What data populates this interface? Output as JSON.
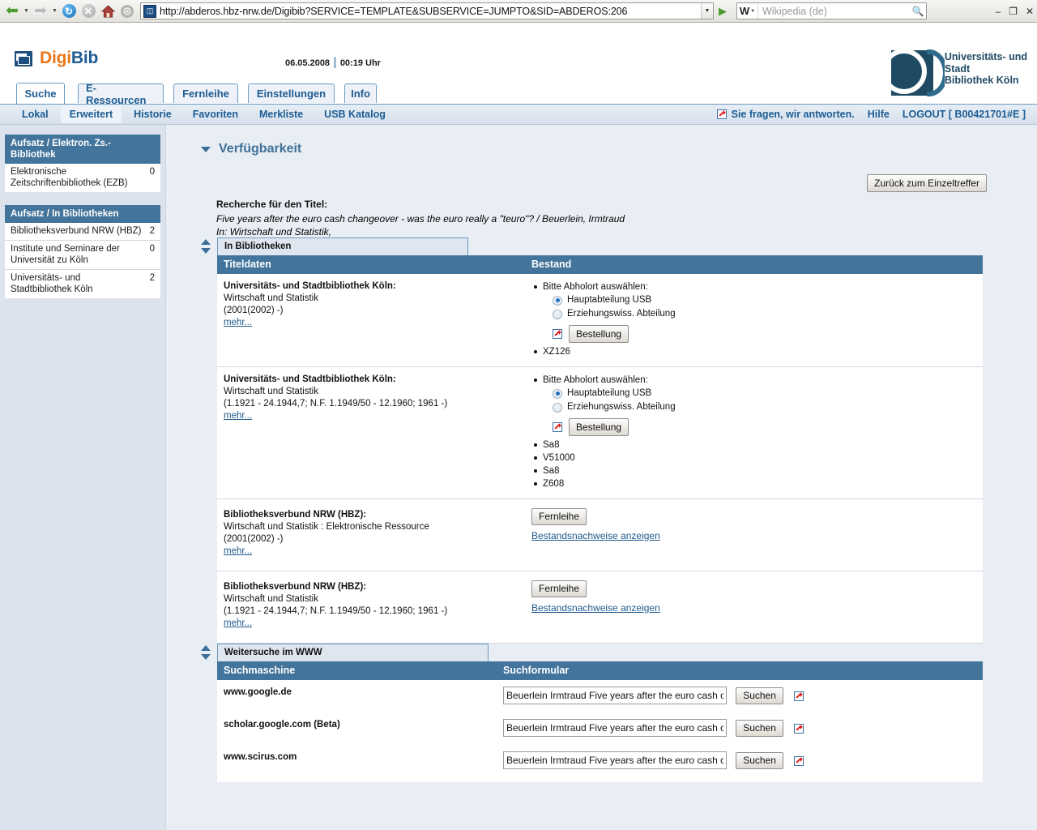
{
  "browser": {
    "back_icon": "back-arrow-icon",
    "forward_icon": "forward-arrow-icon",
    "reload_icon": "reload-icon",
    "stop_icon": "stop-icon",
    "home_icon": "home-icon",
    "settings_icon": "gear-icon",
    "url": "http://abderos.hbz-nrw.de/Digibib?SERVICE=TEMPLATE&SUBSERVICE=JUMPTO&SID=ABDEROS:206",
    "favicon": "digibib-favicon",
    "go_icon": "go-arrow-icon",
    "search_engine_label": "W",
    "search_placeholder": "Wikipedia (de)",
    "search_icon": "magnifier-icon",
    "window_minimize": "–",
    "window_restore": "❐",
    "window_close": "✕"
  },
  "header": {
    "logo_digi": "Digi",
    "logo_bib": "Bib",
    "date": "06.05.2008",
    "separator": "┃",
    "time": "00:19 Uhr",
    "university_logo_lines": [
      "Universitäts- und",
      "Stadt",
      "Bibliothek Köln"
    ]
  },
  "tabs": [
    {
      "label": "Suche",
      "active": true
    },
    {
      "label": "E-Ressourcen",
      "active": false
    },
    {
      "label": "Fernleihe",
      "active": false
    },
    {
      "label": "Einstellungen",
      "active": false
    },
    {
      "label": "Info",
      "active": false
    }
  ],
  "subtabs": [
    {
      "label": "Lokal",
      "selected": false
    },
    {
      "label": "Erweitert",
      "selected": true
    },
    {
      "label": "Historie",
      "selected": false
    },
    {
      "label": "Favoriten",
      "selected": false
    },
    {
      "label": "Merkliste",
      "selected": false
    },
    {
      "label": "USB Katalog",
      "selected": false
    }
  ],
  "subtabs_right": {
    "ask_icon": "external-link-icon",
    "ask_label": "Sie fragen, wir antworten.",
    "help_label": "Hilfe",
    "logout_label": "LOGOUT [ B00421701#E ]"
  },
  "sidebar": {
    "boxes": [
      {
        "title": "Aufsatz / Elektron. Zs.-Bibliothek",
        "rows": [
          {
            "label": "Elektronische Zeitschriftenbibliothek (EZB)",
            "count": "0"
          }
        ]
      },
      {
        "title": "Aufsatz / In Bibliotheken",
        "rows": [
          {
            "label": "Bibliotheksverbund NRW (HBZ)",
            "count": "2"
          },
          {
            "label": "Institute und Seminare der Universität zu Köln",
            "count": "0"
          },
          {
            "label": "Universitäts- und Stadtbibliothek Köln",
            "count": "2"
          }
        ]
      }
    ]
  },
  "main": {
    "section_title": "Verfügbarkeit",
    "collapse_icon": "triangle-down-icon",
    "back_button": "Zurück zum Einzeltreffer",
    "recherche_label": "Recherche für den Titel:",
    "recherche_title": "Five years after the euro cash changeover - was the euro really a \"teuro\"? / Beuerlein, Irmtraud",
    "recherche_in": "In: Wirtschaft und Statistik,",
    "libraries_section": {
      "caption": "In Bibliotheken",
      "toggle_icon": "updown-arrows-icon",
      "columns": [
        "Titeldaten",
        "Bestand"
      ],
      "rows": [
        {
          "title": "Universitäts- und Stadtbibliothek Köln:",
          "line2": "Wirtschaft und Statistik",
          "line3": "(2001(2002) -)",
          "more_label": "mehr...",
          "type": "order",
          "pickup_label": "Bitte Abholort auswählen:",
          "options": [
            {
              "label": "Hauptabteilung USB",
              "selected": true
            },
            {
              "label": "Erziehungswiss. Abteilung",
              "selected": false
            }
          ],
          "order_button": "Bestellung",
          "order_icon": "external-link-icon",
          "signatures": [
            "XZ126"
          ]
        },
        {
          "title": "Universitäts- und Stadtbibliothek Köln:",
          "line2": "Wirtschaft und Statistik",
          "line3": "(1.1921 - 24.1944,7; N.F. 1.1949/50 - 12.1960; 1961 -)",
          "more_label": "mehr...",
          "type": "order",
          "pickup_label": "Bitte Abholort auswählen:",
          "options": [
            {
              "label": "Hauptabteilung USB",
              "selected": true
            },
            {
              "label": "Erziehungswiss. Abteilung",
              "selected": false
            }
          ],
          "order_button": "Bestellung",
          "order_icon": "external-link-icon",
          "signatures": [
            "Sa8",
            "V51000",
            "Sa8",
            "Z608"
          ]
        },
        {
          "title": "Bibliotheksverbund NRW (HBZ):",
          "line2": "Wirtschaft und Statistik : Elektronische Ressource",
          "line3": "(2001(2002) -)",
          "more_label": "mehr...",
          "type": "loan",
          "loan_button": "Fernleihe",
          "holdings_link": "Bestandsnachweise anzeigen"
        },
        {
          "title": "Bibliotheksverbund NRW (HBZ):",
          "line2": "Wirtschaft und Statistik",
          "line3": "(1.1921 - 24.1944,7; N.F. 1.1949/50 - 12.1960; 1961 -)",
          "more_label": "mehr...",
          "type": "loan",
          "loan_button": "Fernleihe",
          "holdings_link": "Bestandsnachweise anzeigen"
        }
      ]
    },
    "www_section": {
      "caption": "Weitersuche im WWW",
      "toggle_icon": "updown-arrows-icon",
      "columns": [
        "Suchmaschine",
        "Suchformular"
      ],
      "search_value": "Beuerlein Irmtraud Five years after the euro cash changeover - was the euro really a \"teuro\"?",
      "search_button": "Suchen",
      "link_icon": "external-link-icon",
      "rows": [
        {
          "engine": "www.google.de"
        },
        {
          "engine": "scholar.google.com (Beta)"
        },
        {
          "engine": "www.scirus.com"
        }
      ]
    }
  }
}
